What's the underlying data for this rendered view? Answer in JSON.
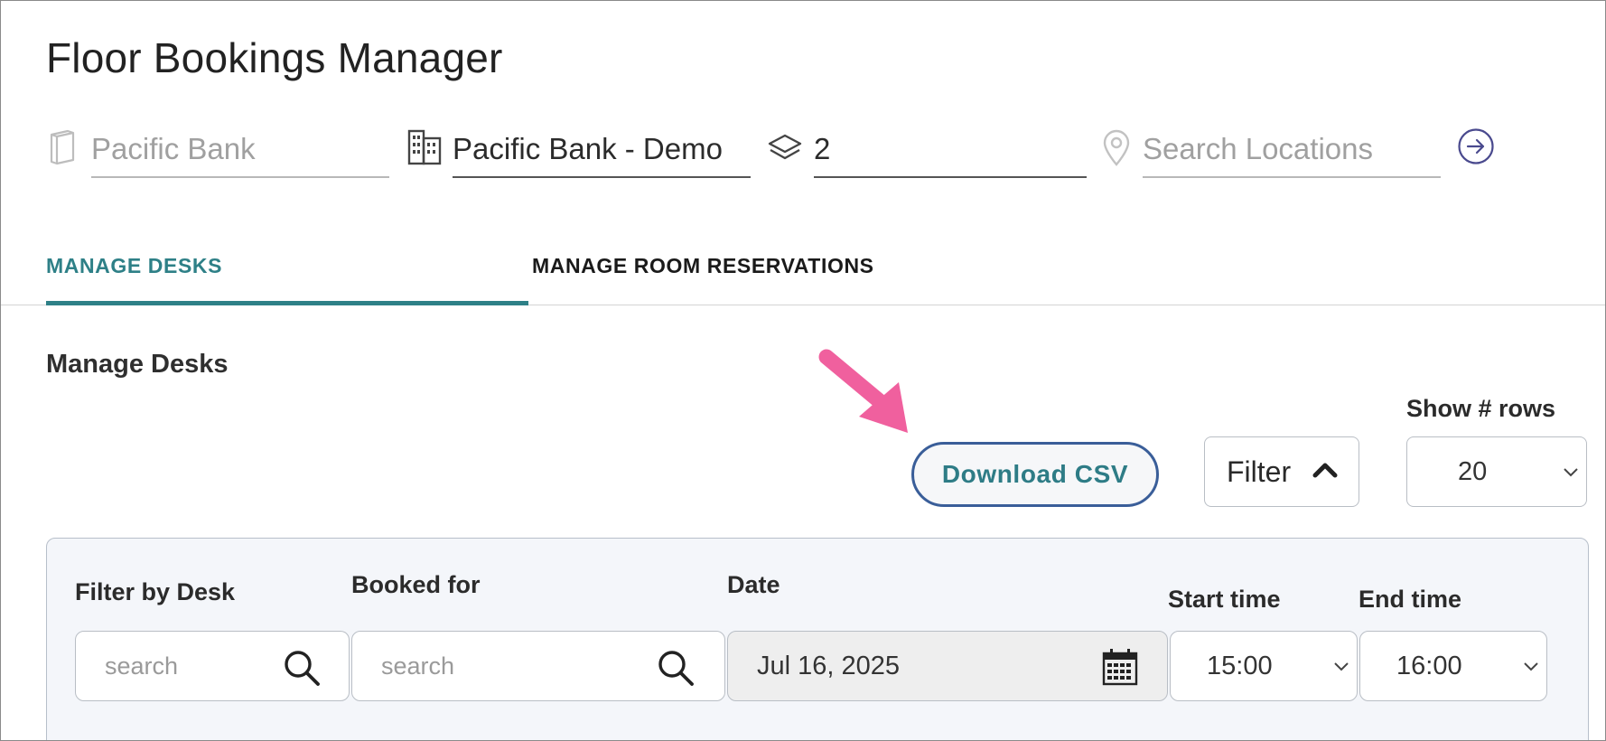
{
  "app": {
    "title": "Floor Bookings Manager"
  },
  "location_bar": {
    "organization": {
      "value": "Pacific Bank",
      "icon": "book-icon"
    },
    "site": {
      "value": "Pacific Bank - Demo",
      "icon": "building-icon"
    },
    "floor": {
      "value": "2",
      "icon": "layers-icon"
    },
    "search": {
      "placeholder": "Search Locations",
      "icon": "map-pin-icon"
    },
    "go_icon": "arrow-right-circle-icon"
  },
  "tabs": [
    {
      "label": "MANAGE DESKS",
      "active": true
    },
    {
      "label": "MANAGE ROOM RESERVATIONS",
      "active": false
    }
  ],
  "section": {
    "title": "Manage Desks"
  },
  "toolbar": {
    "download_label": "Download CSV",
    "filter_label": "Filter",
    "rows_label": "Show # rows",
    "rows_value": "20"
  },
  "filters": {
    "desk": {
      "label": "Filter by Desk",
      "placeholder": "search"
    },
    "booked_for": {
      "label": "Booked for",
      "placeholder": "search"
    },
    "date": {
      "label": "Date",
      "value": "Jul 16, 2025"
    },
    "start_time": {
      "label": "Start time",
      "value": "15:00"
    },
    "end_time": {
      "label": "End time",
      "value": "16:00"
    }
  },
  "colors": {
    "accent": "#2e8087",
    "button_border": "#3a5e99",
    "annotation_arrow": "#f0609e",
    "panel_bg": "#f4f6fa"
  }
}
